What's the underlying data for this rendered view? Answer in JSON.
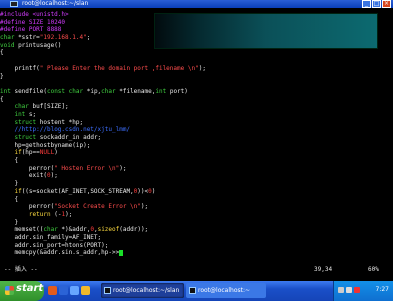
{
  "window": {
    "title": "root@localhost:~/slan",
    "buttons": [
      "_",
      "□",
      "×"
    ]
  },
  "code_lines": [
    [
      {
        "c": "pre",
        "t": "#include <unistd.h>"
      }
    ],
    [
      {
        "c": "pre",
        "t": "#define SIZE 10240"
      }
    ],
    [
      {
        "c": "pre",
        "t": "#define PORT 8888"
      }
    ],
    [
      {
        "c": "type",
        "t": "char"
      },
      {
        "c": "def",
        "t": " *sstr="
      },
      {
        "c": "str",
        "t": "\"192.168.1.4\""
      },
      {
        "c": "def",
        "t": ";"
      }
    ],
    [
      {
        "c": "type",
        "t": "void"
      },
      {
        "c": "def",
        "t": " printusage()"
      }
    ],
    [
      {
        "c": "def",
        "t": "{"
      }
    ],
    [
      {
        "c": "def",
        "t": ""
      }
    ],
    [
      {
        "c": "def",
        "t": "    printf("
      },
      {
        "c": "str",
        "t": "\" Please Enter the domain port ,filename \\n\""
      },
      {
        "c": "def",
        "t": ");"
      }
    ],
    [
      {
        "c": "def",
        "t": "}"
      }
    ],
    [
      {
        "c": "def",
        "t": ""
      }
    ],
    [
      {
        "c": "type",
        "t": "int"
      },
      {
        "c": "def",
        "t": " sendfile("
      },
      {
        "c": "type",
        "t": "const"
      },
      {
        "c": "def",
        "t": " "
      },
      {
        "c": "type",
        "t": "char"
      },
      {
        "c": "def",
        "t": " *ip,"
      },
      {
        "c": "type",
        "t": "char"
      },
      {
        "c": "def",
        "t": " *filename,"
      },
      {
        "c": "type",
        "t": "int"
      },
      {
        "c": "def",
        "t": " port)"
      }
    ],
    [
      {
        "c": "def",
        "t": "{"
      }
    ],
    [
      {
        "c": "def",
        "t": "    "
      },
      {
        "c": "type",
        "t": "char"
      },
      {
        "c": "def",
        "t": " buf[SIZE];"
      }
    ],
    [
      {
        "c": "def",
        "t": "    "
      },
      {
        "c": "type",
        "t": "int"
      },
      {
        "c": "def",
        "t": " s;"
      }
    ],
    [
      {
        "c": "def",
        "t": "    "
      },
      {
        "c": "type",
        "t": "struct"
      },
      {
        "c": "def",
        "t": " hostent *hp;"
      }
    ],
    [
      {
        "c": "def",
        "t": "    "
      },
      {
        "c": "cmt",
        "t": "//http://blog.csdn.net/xjtu_lmm/"
      }
    ],
    [
      {
        "c": "def",
        "t": "    "
      },
      {
        "c": "type",
        "t": "struct"
      },
      {
        "c": "def",
        "t": " sockaddr_in addr;"
      }
    ],
    [
      {
        "c": "def",
        "t": "    hp=gethostbyname(ip);"
      }
    ],
    [
      {
        "c": "def",
        "t": "    "
      },
      {
        "c": "kw",
        "t": "if"
      },
      {
        "c": "def",
        "t": "(hp=="
      },
      {
        "c": "num",
        "t": "NULL"
      },
      {
        "c": "def",
        "t": ")"
      }
    ],
    [
      {
        "c": "def",
        "t": "    {"
      }
    ],
    [
      {
        "c": "def",
        "t": "        perror("
      },
      {
        "c": "str",
        "t": "\" Hosten Error \\n\""
      },
      {
        "c": "def",
        "t": ");"
      }
    ],
    [
      {
        "c": "def",
        "t": "        exit("
      },
      {
        "c": "num",
        "t": "0"
      },
      {
        "c": "def",
        "t": ");"
      }
    ],
    [
      {
        "c": "def",
        "t": "    }"
      }
    ],
    [
      {
        "c": "def",
        "t": "    "
      },
      {
        "c": "kw",
        "t": "if"
      },
      {
        "c": "def",
        "t": "((s=socket(AF_INET,SOCK_STREAM,"
      },
      {
        "c": "num",
        "t": "0"
      },
      {
        "c": "def",
        "t": "))<"
      },
      {
        "c": "num",
        "t": "0"
      },
      {
        "c": "def",
        "t": ")"
      }
    ],
    [
      {
        "c": "def",
        "t": "    {"
      }
    ],
    [
      {
        "c": "def",
        "t": "        perror("
      },
      {
        "c": "str",
        "t": "\"Socket Create Error \\n\""
      },
      {
        "c": "def",
        "t": ");"
      }
    ],
    [
      {
        "c": "def",
        "t": "        "
      },
      {
        "c": "kw",
        "t": "return"
      },
      {
        "c": "def",
        "t": " (-"
      },
      {
        "c": "num",
        "t": "1"
      },
      {
        "c": "def",
        "t": ");"
      }
    ],
    [
      {
        "c": "def",
        "t": "    }"
      }
    ],
    [
      {
        "c": "def",
        "t": "    memset(("
      },
      {
        "c": "type",
        "t": "char"
      },
      {
        "c": "def",
        "t": " *)&addr,"
      },
      {
        "c": "num",
        "t": "0"
      },
      {
        "c": "def",
        "t": ","
      },
      {
        "c": "kw",
        "t": "sizeof"
      },
      {
        "c": "def",
        "t": "(addr));"
      }
    ],
    [
      {
        "c": "def",
        "t": "    addr.sin_family=AF_INET;"
      }
    ],
    [
      {
        "c": "def",
        "t": "    addr.sin_port=htons(PORT);"
      }
    ],
    [
      {
        "c": "def",
        "t": "    memcpy(&addr.sin.s_addr,hp->>"
      }
    ]
  ],
  "status": {
    "mode": "-- 插入 --",
    "position": "39,34",
    "percent": "60%"
  },
  "taskbar": {
    "start_label": "start",
    "tasks": [
      "root@localhost:~/slan",
      "root@localhost:~"
    ],
    "clock": "7:27"
  },
  "colors": {
    "taskbar": "#1a4fc8",
    "start_button": "#3f9f38",
    "cursor": "#19e028",
    "preprocessor": "#d33cff",
    "type_keyword": "#40d040",
    "string": "#ff4d4d"
  }
}
